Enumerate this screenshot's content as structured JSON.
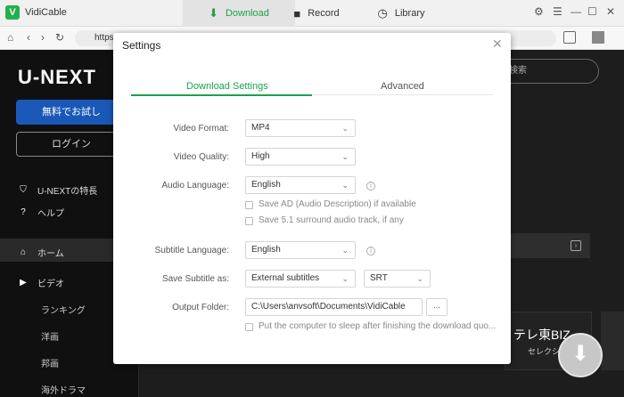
{
  "app": {
    "name": "VidiCable"
  },
  "tabs": [
    {
      "label": "Download",
      "icon": "download-icon"
    },
    {
      "label": "Record",
      "icon": "video-camera-icon"
    },
    {
      "label": "Library",
      "icon": "clock-icon"
    }
  ],
  "window_controls": {
    "settings": "⚙",
    "menu": "☰",
    "minimize": "—",
    "maximize": "☐",
    "close": "✕"
  },
  "browser": {
    "url": "https"
  },
  "site": {
    "brand": "U-NEXT",
    "trial_button": "無料でお試し",
    "login_button": "ログイン",
    "menu": [
      {
        "label": "U-NEXTの特長",
        "icon": "shield-icon"
      },
      {
        "label": "ヘルプ",
        "icon": "help-icon"
      },
      {
        "label": "ホーム",
        "icon": "home-icon"
      },
      {
        "label": "ビデオ",
        "icon": "play-icon"
      }
    ],
    "submenu": [
      "ランキング",
      "洋画",
      "邦画",
      "海外ドラマ"
    ],
    "search_placeholder": "検索",
    "card_title": "テレ東BIZ",
    "card_sub": "セレクシ"
  },
  "settings": {
    "title": "Settings",
    "tabs": [
      "Download Settings",
      "Advanced"
    ],
    "video_format": {
      "label": "Video Format:",
      "value": "MP4"
    },
    "video_quality": {
      "label": "Video Quality:",
      "value": "High"
    },
    "audio_language": {
      "label": "Audio Language:",
      "value": "English"
    },
    "audio_desc": "Save AD (Audio Description) if available",
    "surround": "Save 5.1 surround audio track, if any",
    "subtitle_language": {
      "label": "Subtitle Language:",
      "value": "English"
    },
    "save_subtitle": {
      "label": "Save Subtitle as:",
      "value": "External subtitles",
      "format": "SRT"
    },
    "output_folder": {
      "label": "Output Folder:",
      "value": "C:\\Users\\anvsoft\\Documents\\VidiCable",
      "browse": "..."
    },
    "sleep": "Put the computer to sleep after finishing the download quo..."
  },
  "colors": {
    "accent": "#1aa34a",
    "brand_blue": "#1a58b8"
  }
}
